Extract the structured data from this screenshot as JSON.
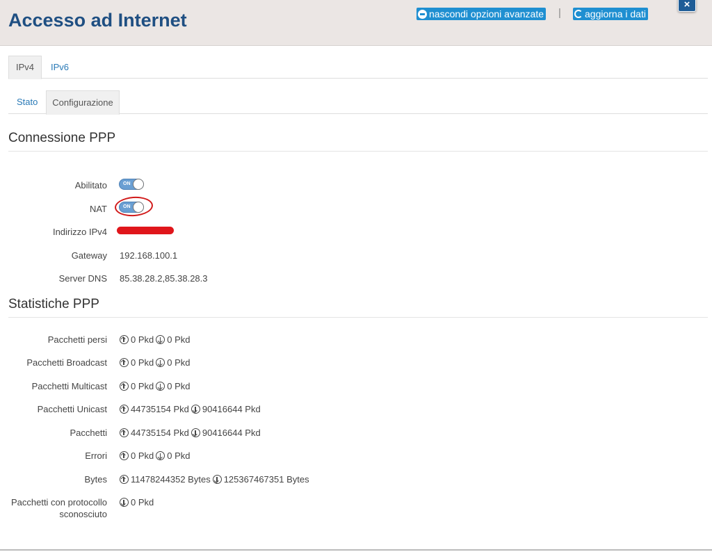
{
  "header": {
    "title": "Accesso ad Internet",
    "hide_advanced": "nascondi opzioni avanzate",
    "separator": "|",
    "refresh": "aggiorna i dati",
    "close": "×"
  },
  "tabs_protocol": [
    "IPv4",
    "IPv6"
  ],
  "tabs_view": [
    "Stato",
    "Configurazione"
  ],
  "ppp_connection": {
    "title": "Connessione PPP",
    "enabled_label": "Abilitato",
    "nat_label": "NAT",
    "toggle_on": "ON",
    "ipv4_label": "Indirizzo IPv4",
    "gateway_label": "Gateway",
    "gateway_value": "192.168.100.1",
    "dns_label": "Server DNS",
    "dns_value": "85.38.28.2,85.38.28.3"
  },
  "ppp_stats": {
    "title": "Statistiche PPP",
    "rows": [
      {
        "label": "Pacchetti persi",
        "up": "0 Pkd",
        "down": "0 Pkd"
      },
      {
        "label": "Pacchetti Broadcast",
        "up": "0 Pkd",
        "down": "0 Pkd"
      },
      {
        "label": "Pacchetti Multicast",
        "up": "0 Pkd",
        "down": "0 Pkd"
      },
      {
        "label": "Pacchetti Unicast",
        "up": "44735154 Pkd",
        "down": "90416644 Pkd"
      },
      {
        "label": "Pacchetti",
        "up": "44735154 Pkd",
        "down": "90416644 Pkd"
      },
      {
        "label": "Errori",
        "up": "0 Pkd",
        "down": "0 Pkd"
      },
      {
        "label": "Bytes",
        "up": "11478244352 Bytes",
        "down": "125367467351 Bytes"
      }
    ],
    "unknown_label_line1": "Pacchetti con protocollo",
    "unknown_label_line2": "sconosciuto",
    "unknown_down": "0 Pkd"
  },
  "colors": {
    "title": "#1f4f82",
    "accent": "#1f8fd1",
    "link": "#2a7ab7",
    "annotation_red": "#d11a1a"
  }
}
